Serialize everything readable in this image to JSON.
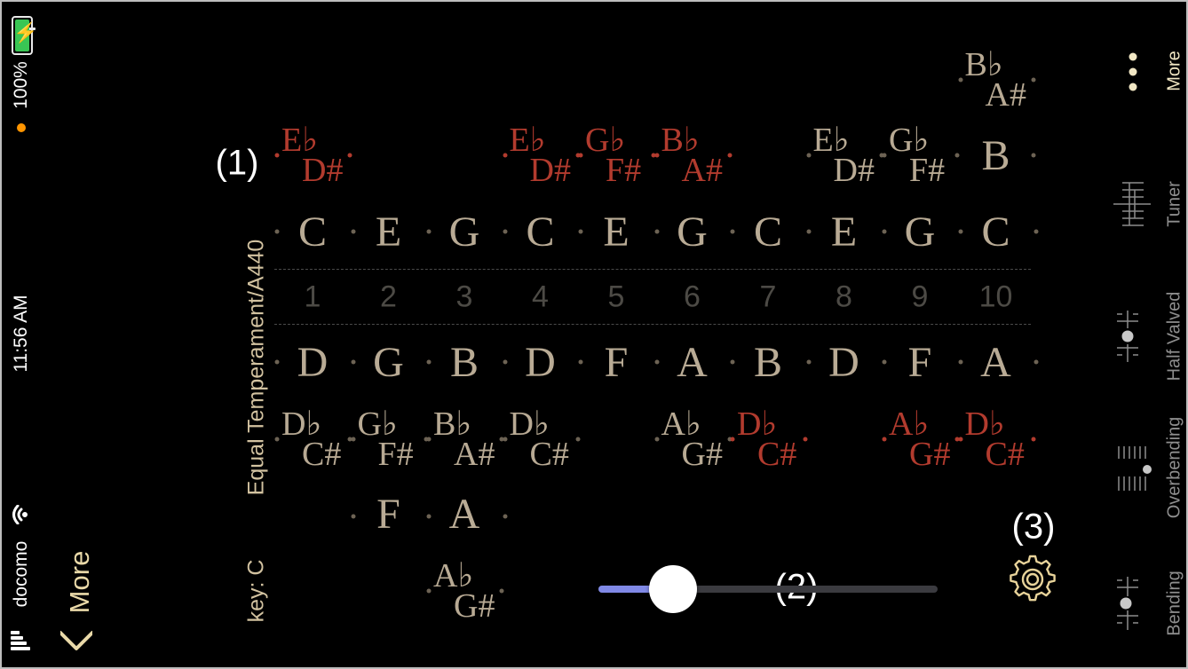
{
  "status_bar": {
    "battery": "100%",
    "time": "11:56 AM",
    "carrier": "docomo",
    "battery_level": 1.0,
    "charging_icon": "bolt-icon",
    "wifi_icon": "wifi-icon",
    "signal_icon": "signal-bars-icon"
  },
  "nav": {
    "back_label": "More",
    "back_icon": "chevron-left-icon"
  },
  "info": {
    "temperament": "Equal Temperament/A440",
    "key": "key: C"
  },
  "callouts": {
    "one": "(1)",
    "two": "(2)",
    "three": "(3)"
  },
  "colors": {
    "natural": "#b9ab95",
    "accidental": "#b8aa94",
    "highlight": "#b23b2e",
    "hole_number": "#4c4a45",
    "menu_active": "#f1e7c4",
    "menu_inactive": "#8e8e8e",
    "slider_fill": "#8089e6",
    "gear": "#e8d39a"
  },
  "holes": [
    "1",
    "2",
    "3",
    "4",
    "5",
    "6",
    "7",
    "8",
    "9",
    "10"
  ],
  "blow": [
    "C",
    "E",
    "G",
    "C",
    "E",
    "G",
    "C",
    "E",
    "G",
    "C"
  ],
  "draw": [
    "D",
    "G",
    "B",
    "D",
    "F",
    "A",
    "B",
    "D",
    "F",
    "A"
  ],
  "blow_bends": [
    {
      "hole": 1,
      "flat": "E♭",
      "sharp": "D#",
      "highlight": true
    },
    {
      "hole": 4,
      "flat": "E♭",
      "sharp": "D#",
      "highlight": true
    },
    {
      "hole": 5,
      "flat": "G♭",
      "sharp": "F#",
      "highlight": true
    },
    {
      "hole": 6,
      "flat": "B♭",
      "sharp": "A#",
      "highlight": true
    },
    {
      "hole": 8,
      "flat": "E♭",
      "sharp": "D#",
      "highlight": false
    },
    {
      "hole": 9,
      "flat": "G♭",
      "sharp": "F#",
      "highlight": false
    }
  ],
  "top_row": [
    {
      "hole": 10,
      "flat": "B♭",
      "sharp": "A#",
      "highlight": false
    }
  ],
  "blow_bend_single": [
    {
      "hole": 10,
      "note": "B",
      "highlight": false
    }
  ],
  "draw_bends": [
    {
      "hole": 1,
      "flat": "D♭",
      "sharp": "C#",
      "highlight": false
    },
    {
      "hole": 2,
      "flat": "G♭",
      "sharp": "F#",
      "highlight": false
    },
    {
      "hole": 3,
      "flat": "B♭",
      "sharp": "A#",
      "highlight": false
    },
    {
      "hole": 4,
      "flat": "D♭",
      "sharp": "C#",
      "highlight": false
    },
    {
      "hole": 6,
      "flat": "A♭",
      "sharp": "G#",
      "highlight": false
    },
    {
      "hole": 7,
      "flat": "D♭",
      "sharp": "C#",
      "highlight": true
    },
    {
      "hole": 9,
      "flat": "A♭",
      "sharp": "G#",
      "highlight": true
    },
    {
      "hole": 10,
      "flat": "D♭",
      "sharp": "C#",
      "highlight": true
    }
  ],
  "draw_bends_2": [
    {
      "hole": 2,
      "note": "F"
    },
    {
      "hole": 3,
      "note": "A"
    }
  ],
  "draw_bends_3": [
    {
      "hole": 3,
      "flat": "A♭",
      "sharp": "G#",
      "highlight": false
    }
  ],
  "slider": {
    "value": 0.22
  },
  "settings_icon": "gear-icon",
  "menu": {
    "more": {
      "label": "More",
      "icon": "vertical-dots-icon",
      "active": true
    },
    "tuner": {
      "label": "Tuner",
      "icon": "tuner-lines-icon"
    },
    "half_valved": {
      "label": "Half Valved",
      "icon": "half-valved-icon"
    },
    "overbending": {
      "label": "Overbending",
      "icon": "overbending-icon"
    },
    "bending": {
      "label": "Bending",
      "icon": "bending-icon"
    }
  }
}
